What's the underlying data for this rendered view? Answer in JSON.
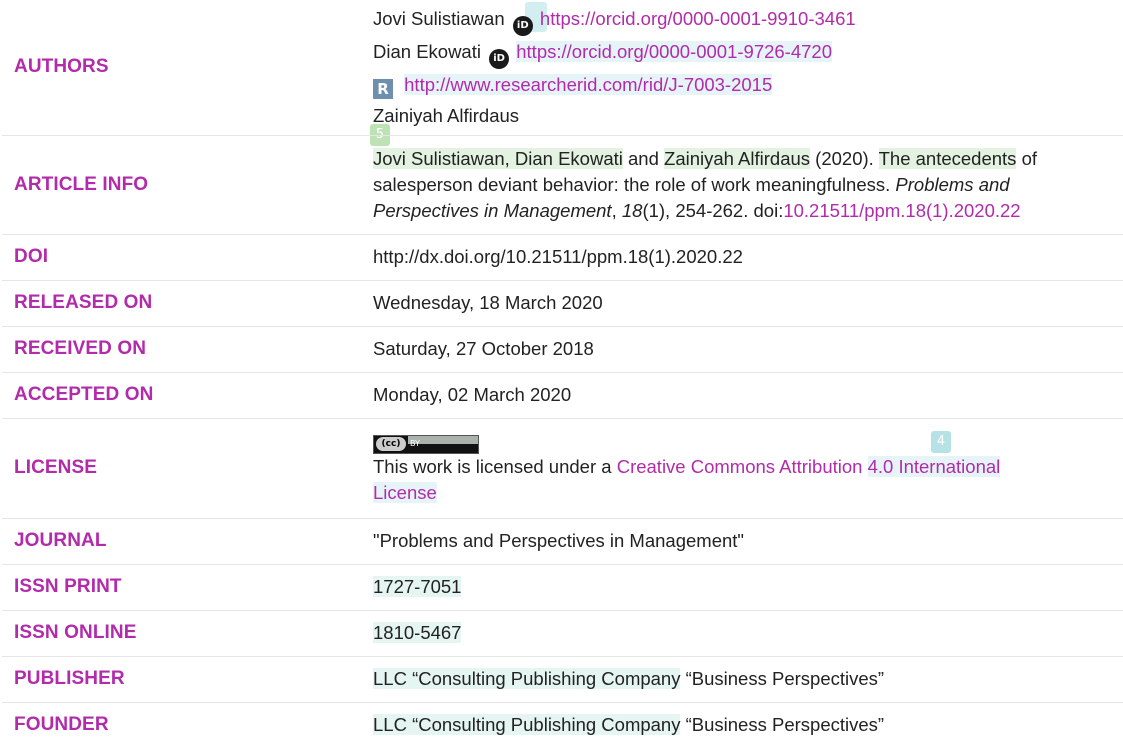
{
  "rows": {
    "authors": {
      "label": "AUTHORS",
      "lines": [
        {
          "name": "Jovi Sulistiawan",
          "orcid_icon": "orcid-icon",
          "url": "https://orcid.org/0000-0001-9910-3461"
        },
        {
          "name": "Dian Ekowati",
          "orcid_icon": "orcid-icon",
          "url": "https://orcid.org/0000-0001-9726-4720"
        },
        {
          "researcher_icon": "researcherid-icon",
          "url": "http://www.researcherid.com/rid/J-7003-2015"
        },
        {
          "name": "Zainiyah Alfirdaus"
        }
      ]
    },
    "article_info": {
      "label": "ARTICLE INFO",
      "authors_part1": "Jovi Sulistiawan, Dian Ekowati",
      "and": " and ",
      "authors_part2": "Zainiyah Alfirdaus",
      "year": " (2020). ",
      "title_highlight": "The antecedents",
      "title_rest": " of salesperson deviant behavior: the role of work meaningfulness. ",
      "journal": "Problems and Perspectives in Management",
      "sep1": ", ",
      "volume": "18",
      "issue_pages": "(1), 254-262. doi:",
      "doi_link": "10.21511/ppm.18(1).2020.22"
    },
    "doi": {
      "label": "DOI",
      "value": "http://dx.doi.org/10.21511/ppm.18(1).2020.22"
    },
    "released": {
      "label": "RELEASED ON",
      "value": "Wednesday, 18 March 2020"
    },
    "received": {
      "label": "RECEIVED ON",
      "value": "Saturday, 27 October 2018"
    },
    "accepted": {
      "label": "ACCEPTED ON",
      "value": "Monday, 02 March 2020"
    },
    "license": {
      "label": "LICENSE",
      "badge_cc": "(cc)",
      "badge_by": "BY",
      "text_prefix": "This work is licensed under a ",
      "link_part1": "Creative Commons Attribution ",
      "link_part2": "4.0 International",
      "link_part3": "License"
    },
    "journal": {
      "label": "JOURNAL",
      "value": "\"Problems and Perspectives in Management\""
    },
    "issn_print": {
      "label": "ISSN PRINT",
      "value": "1727-7051"
    },
    "issn_online": {
      "label": "ISSN ONLINE",
      "value": "1810-5467"
    },
    "publisher": {
      "label": "PUBLISHER",
      "highlight": "LLC “Consulting Publishing Company",
      "rest": " “Business Perspectives”"
    },
    "founder": {
      "label": "FOUNDER",
      "highlight": "LLC “Consulting Publishing Company",
      "rest": " “Business Perspectives”"
    }
  },
  "markers": {
    "m5": "5",
    "m4": "4"
  },
  "colors": {
    "label": "#b22baa",
    "link": "#b22baa",
    "text": "#222222"
  }
}
